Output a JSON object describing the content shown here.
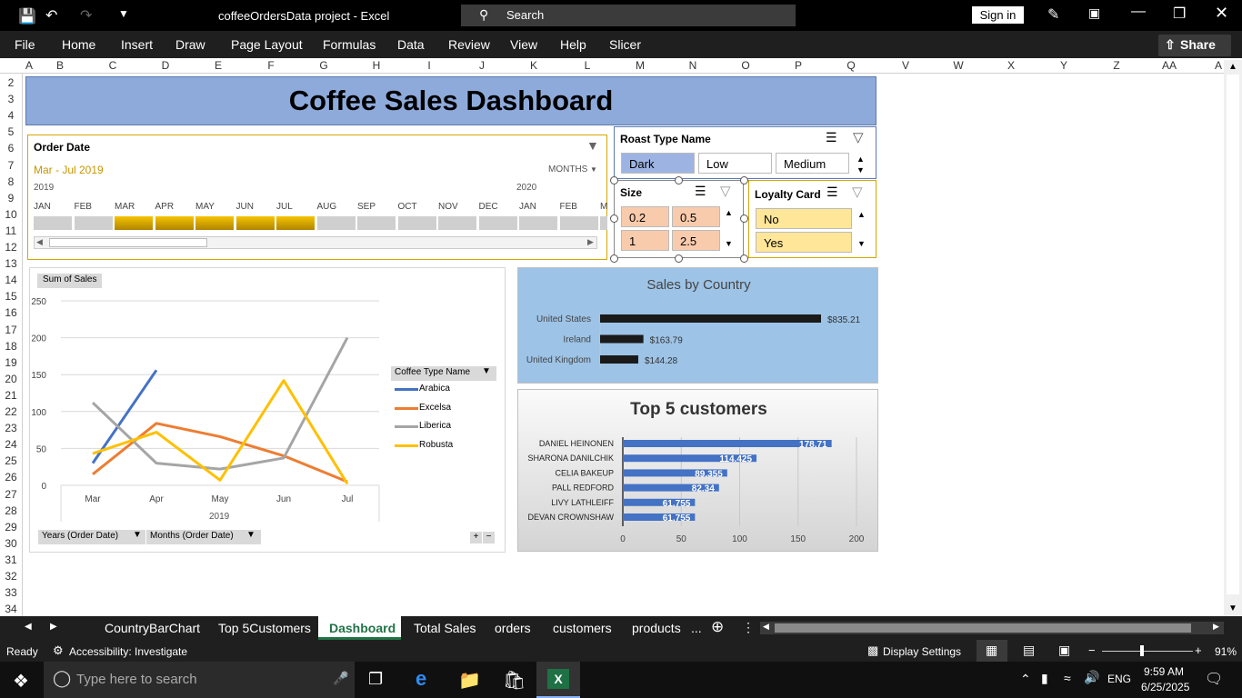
{
  "window": {
    "title": "coffeeOrdersData project  -  Excel",
    "search_placeholder": "Search",
    "sign_in": "Sign in"
  },
  "ribbon": {
    "tabs": [
      "File",
      "Home",
      "Insert",
      "Draw",
      "Page Layout",
      "Formulas",
      "Data",
      "Review",
      "View",
      "Help",
      "Slicer"
    ],
    "share": "Share"
  },
  "columns": [
    "A",
    "B",
    "C",
    "D",
    "E",
    "F",
    "G",
    "H",
    "I",
    "J",
    "K",
    "L",
    "M",
    "N",
    "O",
    "P",
    "Q",
    "V",
    "W",
    "X",
    "Y",
    "Z",
    "AA",
    "A"
  ],
  "rows": [
    "2",
    "3",
    "4",
    "5",
    "6",
    "7",
    "8",
    "9",
    "10",
    "11",
    "12",
    "13",
    "14",
    "15",
    "16",
    "17",
    "18",
    "19",
    "20",
    "21",
    "22",
    "23",
    "24",
    "25",
    "26",
    "27",
    "28",
    "29",
    "30",
    "31",
    "32",
    "33",
    "34"
  ],
  "dashboard": {
    "title": "Coffee Sales Dashboard",
    "timeline": {
      "header": "Order Date",
      "range": "Mar - Jul 2019",
      "level": "MONTHS",
      "year_left": "2019",
      "year_right": "2020",
      "months": [
        "JAN",
        "FEB",
        "MAR",
        "APR",
        "MAY",
        "JUN",
        "JUL",
        "AUG",
        "SEP",
        "OCT",
        "NOV",
        "DEC",
        "JAN",
        "FEB",
        "M"
      ],
      "selected": [
        false,
        false,
        true,
        true,
        true,
        true,
        true,
        false,
        false,
        false,
        false,
        false,
        false,
        false,
        false
      ]
    },
    "roast_slicer": {
      "header": "Roast Type Name",
      "items": [
        "Dark",
        "Low",
        "Medium"
      ]
    },
    "size_slicer": {
      "header": "Size",
      "items": [
        "0.2",
        "0.5",
        "1",
        "2.5"
      ]
    },
    "loyalty_slicer": {
      "header": "Loyalty Card",
      "items": [
        "No",
        "Yes"
      ]
    },
    "line_chart": {
      "field_button": "Sum of Sales",
      "legend_header": "Coffee Type Name",
      "year_label": "2019",
      "filter_years": "Years (Order Date)",
      "filter_months": "Months (Order Date)"
    },
    "country_chart": {
      "title": "Sales by Country"
    },
    "top_customers": {
      "title": "Top 5 customers"
    }
  },
  "chart_data": [
    {
      "type": "line",
      "categories": [
        "Mar",
        "Apr",
        "May",
        "Jun",
        "Jul"
      ],
      "ylim": [
        0,
        250
      ],
      "yticks": [
        "0",
        "50",
        "100",
        "150",
        "200",
        "250"
      ],
      "series": [
        {
          "name": "Arabica",
          "color": "#4472c4",
          "values": [
            30,
            156,
            null,
            null,
            null
          ]
        },
        {
          "name": "Excelsa",
          "color": "#ed7d31",
          "values": [
            15,
            84,
            66,
            40,
            5
          ]
        },
        {
          "name": "Liberica",
          "color": "#a5a5a5",
          "values": [
            112,
            30,
            22,
            37,
            200
          ]
        },
        {
          "name": "Robusta",
          "color": "#ffc000",
          "values": [
            43,
            72,
            7,
            142,
            2
          ]
        }
      ]
    },
    {
      "type": "bar",
      "title": "Sales by Country",
      "categories": [
        "United States",
        "Ireland",
        "United Kingdom"
      ],
      "values": [
        835.21,
        163.79,
        144.28
      ],
      "labels": [
        "$835.21",
        "$163.79",
        "$144.28"
      ]
    },
    {
      "type": "bar",
      "title": "Top 5 customers",
      "categories": [
        "DANIEL HEINONEN",
        "SHARONA DANILCHIK",
        "CELIA BAKEUP",
        "PALL REDFORD",
        "LIVY LATHLEIFF",
        "DEVAN CROWNSHAW"
      ],
      "values": [
        178.71,
        114.425,
        89.355,
        82.34,
        61.755,
        61.755
      ],
      "labels": [
        "178.71",
        "114.425",
        "89.355",
        "82.34",
        "61.755",
        "61.755"
      ],
      "xlim": [
        0,
        200
      ],
      "xticks": [
        "0",
        "50",
        "100",
        "150",
        "200"
      ]
    }
  ],
  "sheet_tabs": [
    "CountryBarChart",
    "Top 5Customers",
    "Dashboard",
    "Total Sales",
    "orders",
    "customers",
    "products"
  ],
  "active_sheet": "Dashboard",
  "status": {
    "ready": "Ready",
    "accessibility": "Accessibility: Investigate",
    "display": "Display Settings",
    "zoom": "91%"
  },
  "taskbar": {
    "search": "Type here to search",
    "lang": "ENG",
    "time": "9:59 AM",
    "date": "6/25/2025"
  }
}
